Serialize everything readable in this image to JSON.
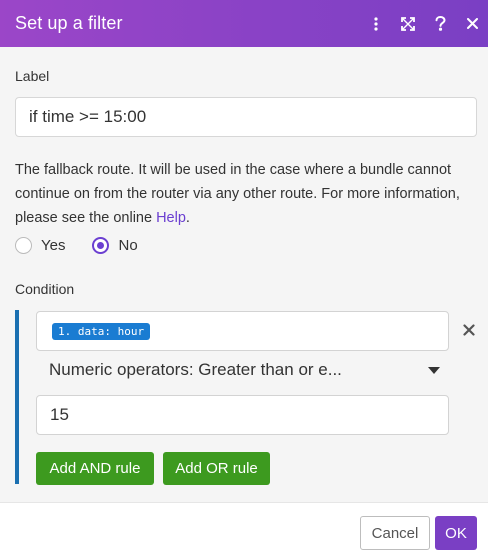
{
  "dialog": {
    "title": "Set up a filter"
  },
  "form": {
    "label_title": "Label",
    "label_value": "if time >= 15:00",
    "description_text": "The fallback route. It will be used in the case where a bundle cannot continue on from the router via any other route. For more information, please see the online ",
    "description_link": "Help",
    "description_end": ".",
    "radio_yes": "Yes",
    "radio_no": "No",
    "fallback_selected": "No",
    "condition_title": "Condition"
  },
  "condition": {
    "operand_pill": "1. data: hour",
    "operator": "Numeric operators: Greater than or e...",
    "value": "15",
    "add_and": "Add AND rule",
    "add_or": "Add OR rule"
  },
  "footer": {
    "cancel": "Cancel",
    "ok": "OK"
  },
  "colors": {
    "header_gradient_start": "#9b46c8",
    "header_gradient_end": "#7a3fc4",
    "accent_purple": "#6b3fd1",
    "pill_blue": "#1a7cd2",
    "condition_bar": "#1a6fb0",
    "green_button": "#3d9a1f"
  },
  "icons": {
    "header": [
      "more-vertical-icon",
      "expand-icon",
      "help-icon",
      "close-icon"
    ],
    "condition": [
      "remove-icon",
      "caret-down-icon"
    ]
  }
}
